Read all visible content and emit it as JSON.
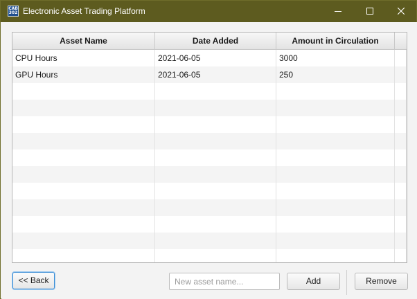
{
  "window": {
    "title": "Electronic Asset Trading Platform",
    "icon_text": [
      "CAB",
      "302"
    ],
    "controls": [
      "minimize-icon",
      "maximize-icon",
      "close-icon"
    ]
  },
  "table": {
    "columns": [
      "Asset Name",
      "Date Added",
      "Amount in Circulation"
    ],
    "rows": [
      {
        "name": "CPU Hours",
        "date": "2021-06-05",
        "amount": "3000"
      },
      {
        "name": "GPU Hours",
        "date": "2021-06-05",
        "amount": "250"
      }
    ],
    "empty_row_count": 11
  },
  "footer": {
    "back_label": "<< Back",
    "new_asset_placeholder": "New asset name...",
    "add_label": "Add",
    "remove_label": "Remove"
  },
  "colors": {
    "titlebar": "#5d5b1f",
    "focus_border": "#3c8ed6"
  }
}
